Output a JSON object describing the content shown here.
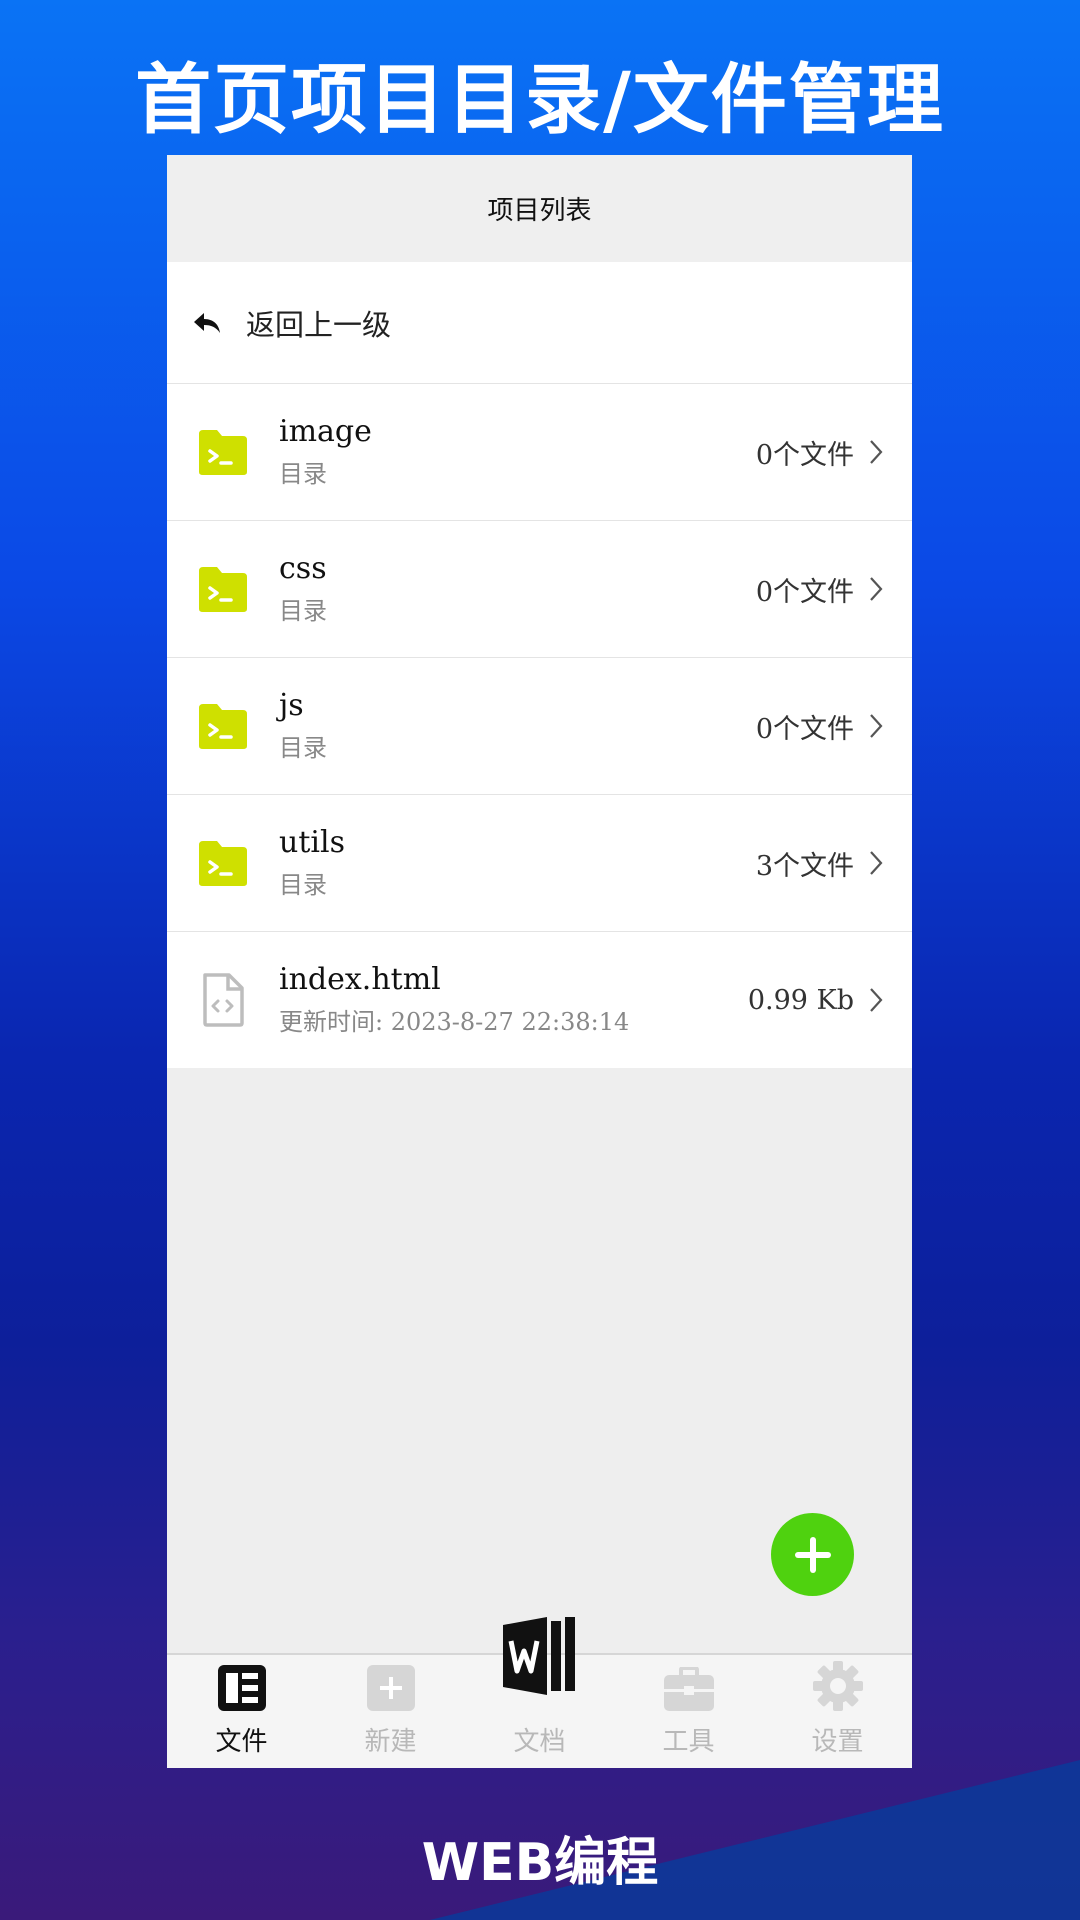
{
  "promo": {
    "title": "首页项目目录/文件管理",
    "footer": "WEB编程"
  },
  "header": {
    "title": "项目列表"
  },
  "back": {
    "label": "返回上一级",
    "icon": "reply-arrow-icon"
  },
  "items": [
    {
      "name": "image",
      "sub": "目录",
      "right": "0个文件",
      "type": "folder"
    },
    {
      "name": "css",
      "sub": "目录",
      "right": "0个文件",
      "type": "folder"
    },
    {
      "name": "js",
      "sub": "目录",
      "right": "0个文件",
      "type": "folder"
    },
    {
      "name": "utils",
      "sub": "目录",
      "right": "3个文件",
      "type": "folder"
    },
    {
      "name": "index.html",
      "sub": "更新时间: 2023-8-27 22:38:14",
      "right": "0.99 Kb",
      "type": "file"
    }
  ],
  "tabs": [
    {
      "label": "文件",
      "icon": "file-list-icon",
      "active": true
    },
    {
      "label": "新建",
      "icon": "plus-square-icon",
      "active": false
    },
    {
      "label": "文档",
      "icon": "word-doc-icon",
      "active": false
    },
    {
      "label": "工具",
      "icon": "toolbox-icon",
      "active": false
    },
    {
      "label": "设置",
      "icon": "gear-icon",
      "active": false
    }
  ],
  "colors": {
    "folder": "#cfe000",
    "fab": "#4fd20f",
    "active_tab": "#111111",
    "inactive_tab": "#b8b8b8"
  }
}
